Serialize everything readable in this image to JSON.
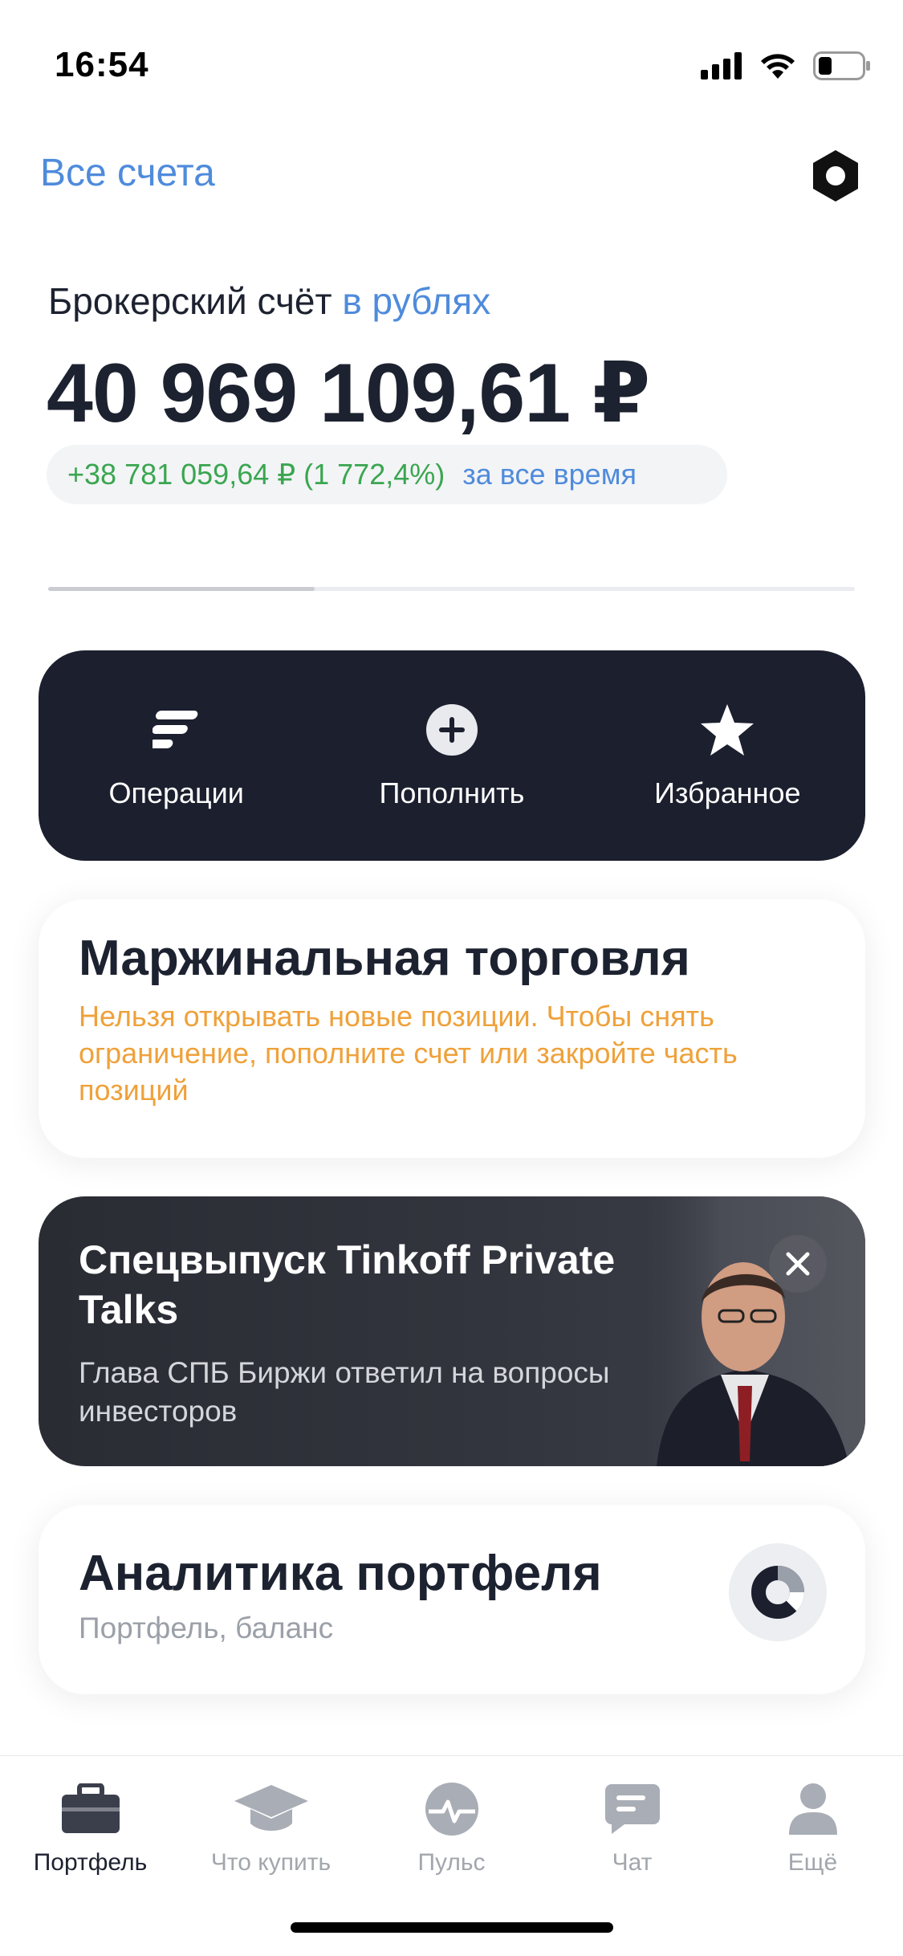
{
  "status_bar": {
    "time": "16:54",
    "icons": [
      "signal-icon",
      "wifi-icon",
      "battery-icon"
    ]
  },
  "header": {
    "accounts_link": "Все счета",
    "settings_icon": "hexagon-settings-icon"
  },
  "account": {
    "label": "Брокерский счёт",
    "currency_label": "в рублях",
    "balance": "40 969 109,61 ₽",
    "profit": "+38 781 059,64 ₽ (1 772,4%)",
    "profit_period": "за все время",
    "pager_progress": 0.33
  },
  "actions": [
    {
      "label": "Операции",
      "icon": "operations-icon"
    },
    {
      "label": "Пополнить",
      "icon": "plus-circle-icon"
    },
    {
      "label": "Избранное",
      "icon": "star-icon"
    }
  ],
  "margin_card": {
    "title": "Маржинальная торговля",
    "text": "Нельзя открывать новые позиции. Чтобы снять ограничение, пополните счет или закройте часть позиций"
  },
  "promo": {
    "title": "Спецвыпуск Tinkoff Private Talks",
    "subtitle": "Глава СПБ Биржи ответил на вопросы инвесторов"
  },
  "analytics_card": {
    "title": "Аналитика портфеля",
    "subtitle": "Портфель, баланс",
    "icon": "donut-chart-icon"
  },
  "tabbar": [
    {
      "label": "Портфель",
      "icon": "briefcase-icon",
      "active": true
    },
    {
      "label": "Что купить",
      "icon": "graduation-cap-icon",
      "active": false
    },
    {
      "label": "Пульс",
      "icon": "pulse-icon",
      "active": false
    },
    {
      "label": "Чат",
      "icon": "chat-icon",
      "active": false
    },
    {
      "label": "Ещё",
      "icon": "profile-icon",
      "active": false
    }
  ],
  "colors": {
    "accent_blue": "#4f8bdc",
    "profit_green": "#3aa650",
    "warning_orange": "#efa13a",
    "dark_panel": "#1b1f2e"
  }
}
